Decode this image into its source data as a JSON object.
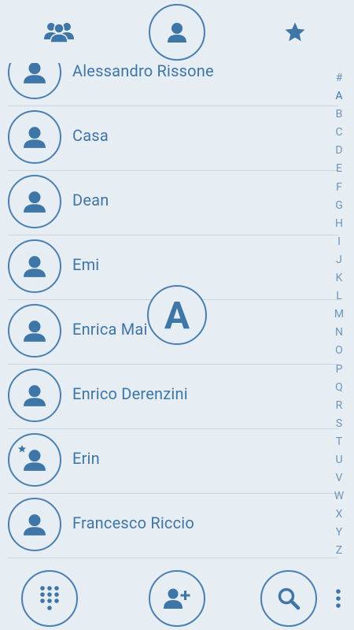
{
  "top_nav": {
    "groups_icon": "groups-icon",
    "contacts_icon": "person-icon",
    "favorites_icon": "star-icon"
  },
  "contacts": [
    {
      "name": "Alessandro Rissone",
      "favorite": false
    },
    {
      "name": "Casa",
      "favorite": false
    },
    {
      "name": "Dean",
      "favorite": false
    },
    {
      "name": "Emi",
      "favorite": false
    },
    {
      "name": "Enrica Mai",
      "favorite": false
    },
    {
      "name": "Enrico Derenzini",
      "favorite": false
    },
    {
      "name": "Erin",
      "favorite": true
    },
    {
      "name": "Francesco Riccio",
      "favorite": false
    }
  ],
  "index_letters": [
    "#",
    "A",
    "B",
    "C",
    "D",
    "E",
    "F",
    "G",
    "H",
    "I",
    "J",
    "K",
    "L",
    "M",
    "N",
    "O",
    "P",
    "Q",
    "R",
    "S",
    "T",
    "U",
    "V",
    "W",
    "X",
    "Y",
    "Z"
  ],
  "scroll_letter": "A",
  "bottom_nav": {
    "dialpad_icon": "dialpad-icon",
    "add_contact_icon": "add-contact-icon",
    "search_icon": "search-icon",
    "menu_icon": "overflow-menu-icon"
  },
  "colors": {
    "background": "#e6edf3",
    "accent": "#4a80b0",
    "text": "#3f76a8"
  }
}
